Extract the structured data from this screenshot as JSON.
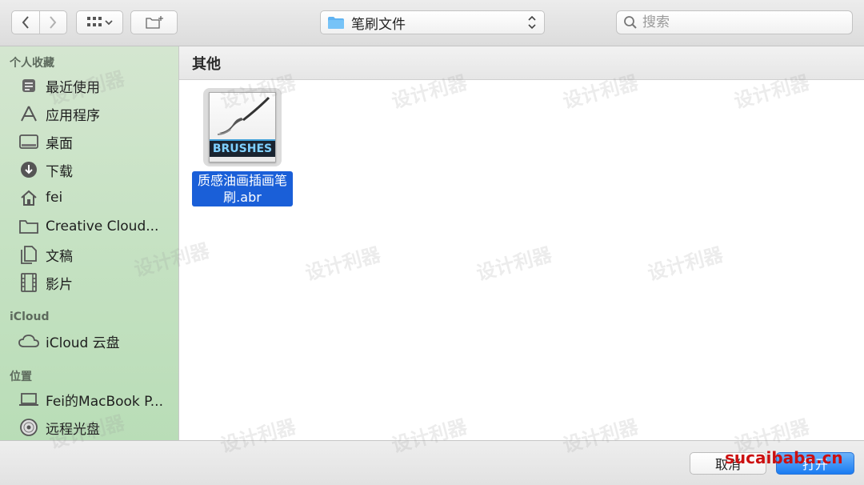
{
  "toolbar": {
    "path_label": "笔刷文件",
    "search_placeholder": "搜索"
  },
  "sidebar": {
    "sections": [
      {
        "title": "个人收藏"
      },
      {
        "title": "iCloud"
      },
      {
        "title": "位置"
      }
    ],
    "favorites": [
      {
        "label": "最近使用",
        "icon": "clock-icon"
      },
      {
        "label": "应用程序",
        "icon": "applications-icon"
      },
      {
        "label": "桌面",
        "icon": "desktop-icon"
      },
      {
        "label": "下载",
        "icon": "download-icon"
      },
      {
        "label": "fei",
        "icon": "home-icon"
      },
      {
        "label": "Creative Cloud...",
        "icon": "folder-icon"
      },
      {
        "label": "文稿",
        "icon": "documents-icon"
      },
      {
        "label": "影片",
        "icon": "film-icon"
      }
    ],
    "icloud": [
      {
        "label": "iCloud 云盘",
        "icon": "cloud-icon"
      }
    ],
    "locations": [
      {
        "label": "Fei的MacBook P...",
        "icon": "laptop-icon"
      },
      {
        "label": "远程光盘",
        "icon": "disc-icon"
      }
    ]
  },
  "main": {
    "header": "其他",
    "files": [
      {
        "thumb_text": "BRUSHES",
        "name": "质感油画插画笔刷.abr",
        "selected": true
      }
    ]
  },
  "buttons": {
    "cancel": "取消",
    "open": "打开"
  },
  "watermark": {
    "text": "设计利器",
    "site": "sucaibaba.cn"
  },
  "colors": {
    "selection": "#1a5fd8",
    "primary_button": "#1a7cf2",
    "sidebar_bg": "#c7e2c4"
  }
}
